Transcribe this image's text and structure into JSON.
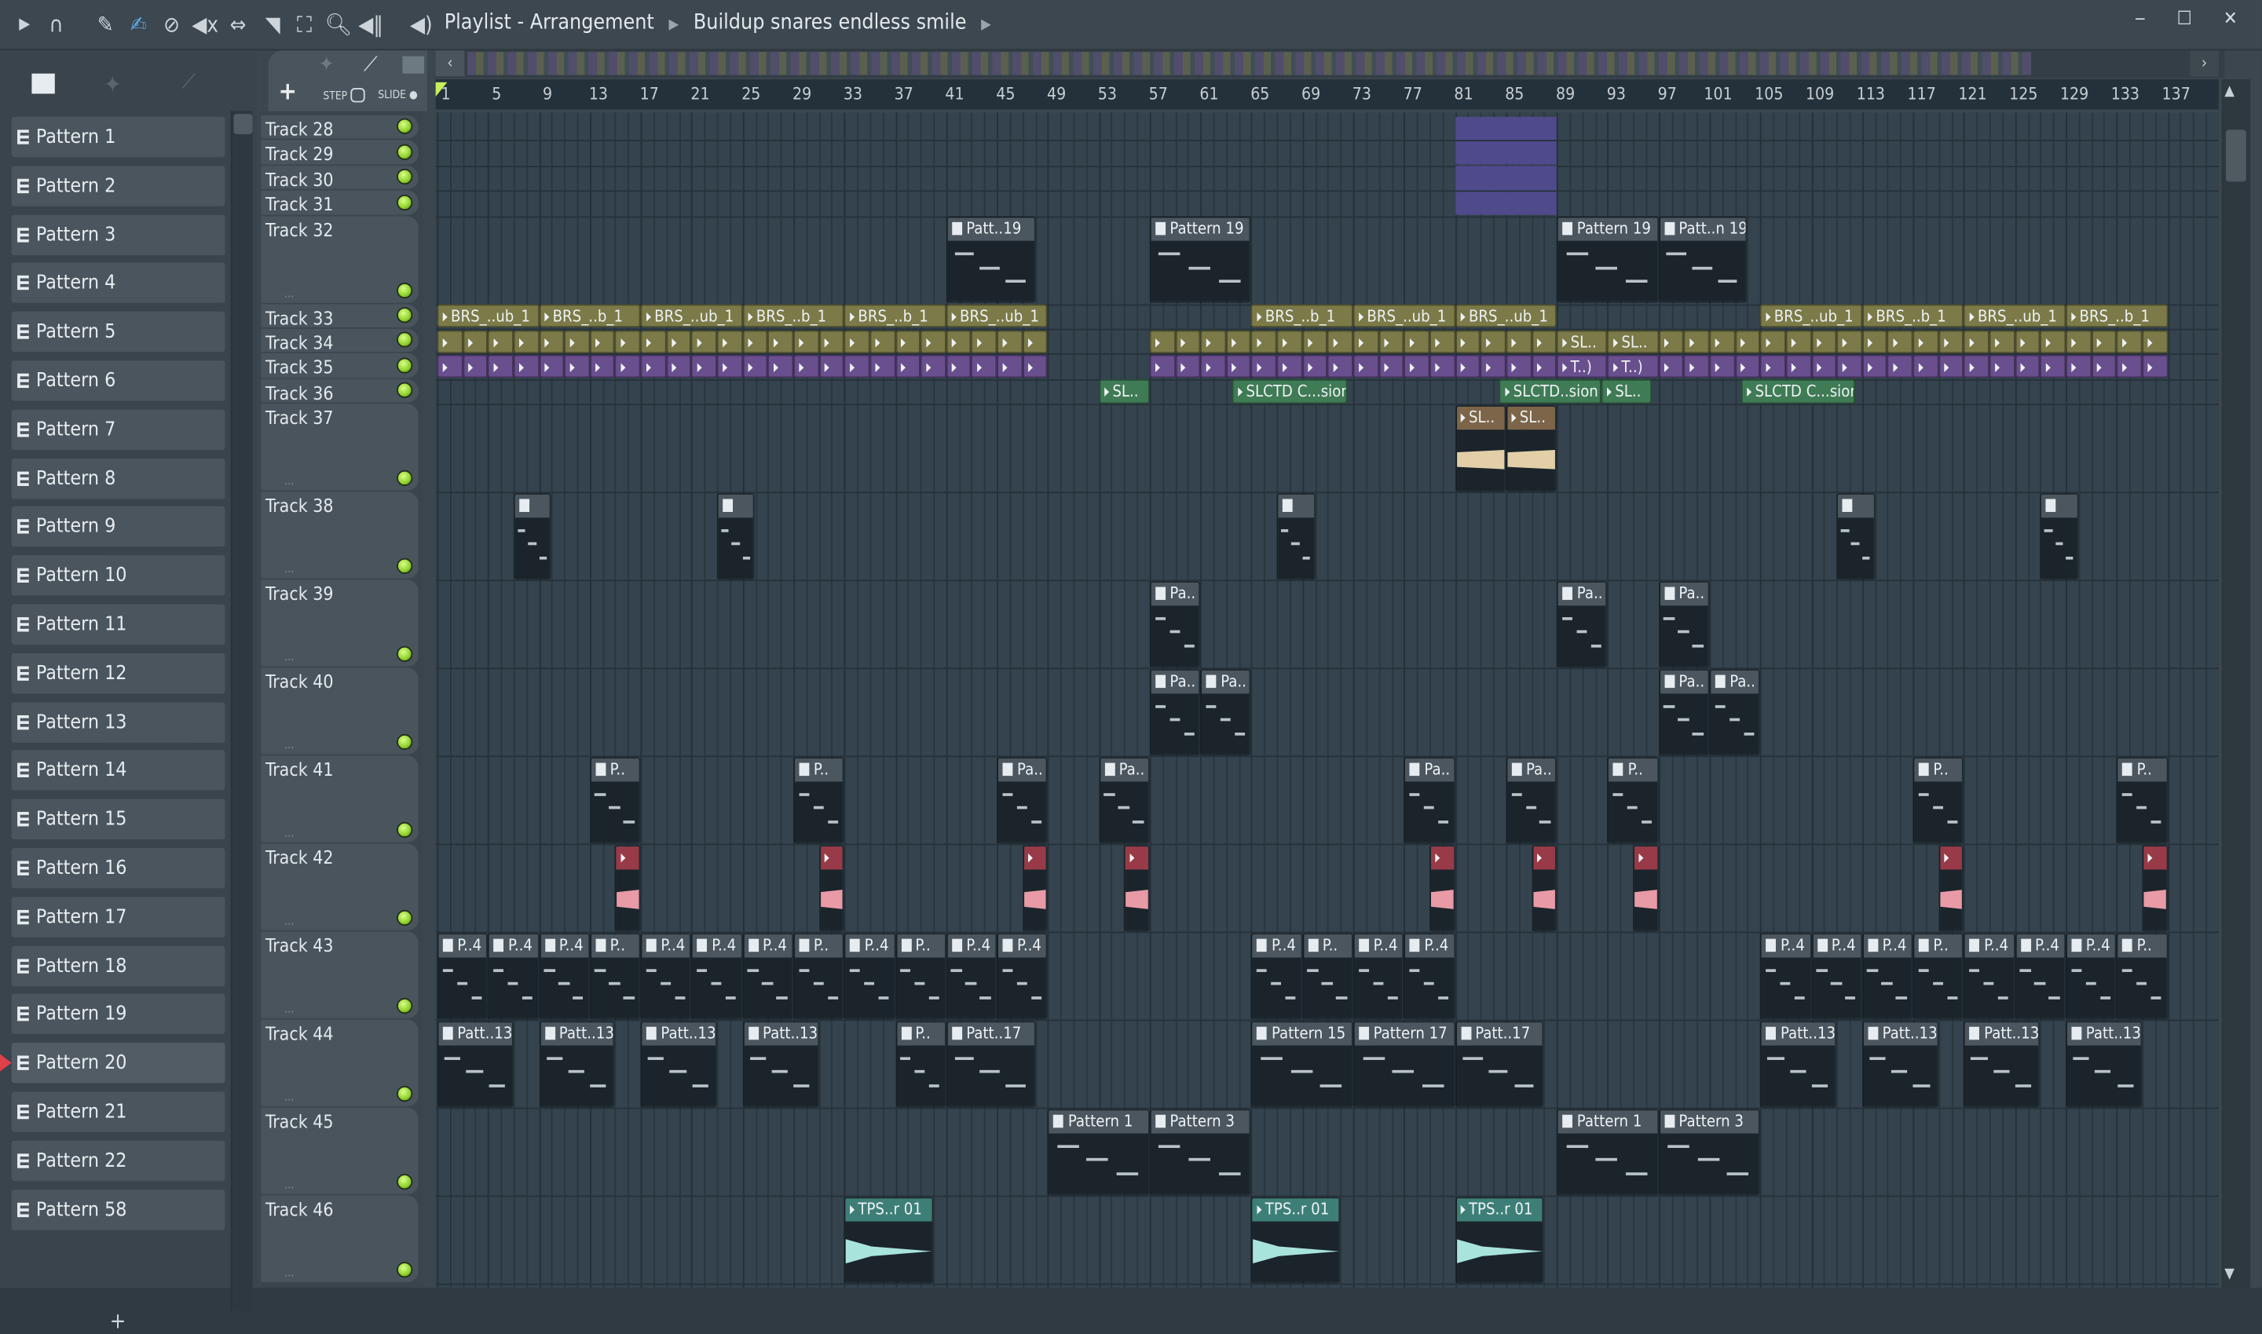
{
  "window": {
    "title": "Playlist - Arrangement",
    "breadcrumb": "Buildup snares endless smile",
    "controls": "‒ ☐ ✕"
  },
  "toolbar": {
    "icons": [
      "arrow-right-icon",
      "magnet-icon",
      "pencil-icon",
      "paint-icon",
      "delete-icon",
      "mute-icon",
      "slip-icon",
      "slice-icon",
      "select-icon",
      "zoom-icon",
      "playback-icon",
      "speaker-icon"
    ],
    "accent": "#5aa8e6"
  },
  "panel": {
    "step_label": "STEP",
    "slide_label": "SLIDE",
    "add_label": "+",
    "add_pattern_label": "+"
  },
  "patterns": [
    "Pattern 1",
    "Pattern 2",
    "Pattern 3",
    "Pattern 4",
    "Pattern 5",
    "Pattern 6",
    "Pattern 7",
    "Pattern 8",
    "Pattern 9",
    "Pattern 10",
    "Pattern 11",
    "Pattern 12",
    "Pattern 13",
    "Pattern 14",
    "Pattern 15",
    "Pattern 16",
    "Pattern 17",
    "Pattern 18",
    "Pattern 19",
    "Pattern 20",
    "Pattern 21",
    "Pattern 22",
    "Pattern 58"
  ],
  "selected_pattern": "Pattern 20",
  "ruler": {
    "labels": [
      1,
      5,
      9,
      13,
      17,
      21,
      25,
      29,
      33,
      37,
      41,
      45,
      49,
      53,
      57,
      61,
      65,
      69,
      73,
      77,
      81,
      85,
      89,
      93,
      97,
      101,
      105,
      109,
      113,
      117,
      121,
      125,
      129,
      133,
      137
    ]
  },
  "colors": {
    "pattern": "#4b565f",
    "olive": "#7b7a48",
    "purple": "#6a4f8f",
    "green": "#3f7b55",
    "brown": "#7c6548",
    "red": "#983a47",
    "teal": "#3d7f77",
    "block": "#4f4a8c"
  },
  "tracks": [
    {
      "name": "Track 28",
      "size": "s",
      "clips": [
        {
          "start": 81,
          "len": 8,
          "type": "block",
          "label": ""
        }
      ]
    },
    {
      "name": "Track 29",
      "size": "s",
      "clips": [
        {
          "start": 81,
          "len": 8,
          "type": "block",
          "label": ""
        }
      ]
    },
    {
      "name": "Track 30",
      "size": "s",
      "clips": [
        {
          "start": 81,
          "len": 8,
          "type": "block",
          "label": ""
        }
      ]
    },
    {
      "name": "Track 31",
      "size": "s",
      "clips": [
        {
          "start": 81,
          "len": 8,
          "type": "block",
          "label": ""
        }
      ]
    },
    {
      "name": "Track 32",
      "size": "l",
      "clips": [
        {
          "start": 41,
          "len": 7,
          "type": "pattern",
          "label": "Patt..19"
        },
        {
          "start": 57,
          "len": 8,
          "type": "pattern",
          "label": "Pattern 19"
        },
        {
          "start": 89,
          "len": 8,
          "type": "pattern",
          "label": "Pattern 19"
        },
        {
          "start": 97,
          "len": 7,
          "type": "pattern",
          "label": "Patt..n 19"
        }
      ]
    },
    {
      "name": "Track 33",
      "size": "s",
      "clips": [
        {
          "start": 1,
          "len": 8,
          "type": "olive",
          "label": "BRS_..ub_1"
        },
        {
          "start": 9,
          "len": 8,
          "type": "olive",
          "label": "BRS_..b_1"
        },
        {
          "start": 17,
          "len": 8,
          "type": "olive",
          "label": "BRS_..ub_1"
        },
        {
          "start": 25,
          "len": 8,
          "type": "olive",
          "label": "BRS_..b_1"
        },
        {
          "start": 33,
          "len": 8,
          "type": "olive",
          "label": "BRS_..b_1"
        },
        {
          "start": 41,
          "len": 8,
          "type": "olive",
          "label": "BRS_..ub_1"
        },
        {
          "start": 65,
          "len": 8,
          "type": "olive",
          "label": "BRS_..b_1"
        },
        {
          "start": 73,
          "len": 8,
          "type": "olive",
          "label": "BRS_..ub_1"
        },
        {
          "start": 81,
          "len": 8,
          "type": "olive",
          "label": "BRS_..ub_1"
        },
        {
          "start": 105,
          "len": 8,
          "type": "olive",
          "label": "BRS_..ub_1"
        },
        {
          "start": 113,
          "len": 8,
          "type": "olive",
          "label": "BRS_..b_1"
        },
        {
          "start": 121,
          "len": 8,
          "type": "olive",
          "label": "BRS_..ub_1"
        },
        {
          "start": 129,
          "len": 8,
          "type": "olive",
          "label": "BRS_..b_1"
        }
      ]
    },
    {
      "name": "Track 34",
      "size": "s",
      "repeat": [
        {
          "from": 1,
          "to": 49,
          "every": 2,
          "type": "olive"
        },
        {
          "from": 57,
          "to": 89,
          "every": 2,
          "type": "olive"
        },
        {
          "from": 97,
          "to": 105,
          "every": 2,
          "type": "olive"
        },
        {
          "from": 105,
          "to": 137,
          "every": 2,
          "type": "olive"
        }
      ],
      "clips": [
        {
          "start": 89,
          "len": 4,
          "type": "olive",
          "label": "SL.."
        },
        {
          "start": 93,
          "len": 4,
          "type": "olive",
          "label": "SL.."
        }
      ]
    },
    {
      "name": "Track 35",
      "size": "s",
      "repeat": [
        {
          "from": 1,
          "to": 49,
          "every": 2,
          "type": "purple"
        },
        {
          "from": 57,
          "to": 89,
          "every": 2,
          "type": "purple"
        },
        {
          "from": 97,
          "to": 137,
          "every": 2,
          "type": "purple"
        }
      ],
      "clips": [
        {
          "start": 89,
          "len": 4,
          "type": "purple",
          "label": "T..)"
        },
        {
          "start": 93,
          "len": 4,
          "type": "purple",
          "label": "T..)"
        }
      ]
    },
    {
      "name": "Track 36",
      "size": "s",
      "clips": [
        {
          "start": 53,
          "len": 4,
          "type": "green",
          "label": "SL.."
        },
        {
          "start": 63.5,
          "len": 9,
          "type": "green",
          "label": "SLCTD C...sion"
        },
        {
          "start": 84.5,
          "len": 8,
          "type": "green",
          "label": "SLCTD..sion"
        },
        {
          "start": 92.5,
          "len": 4,
          "type": "green",
          "label": "SL.."
        },
        {
          "start": 103.5,
          "len": 9,
          "type": "green",
          "label": "SLCTD C...sion"
        }
      ]
    },
    {
      "name": "Track 37",
      "size": "l",
      "clips": [
        {
          "start": 81,
          "len": 4,
          "type": "brown",
          "label": "SL..",
          "wave": true
        },
        {
          "start": 85,
          "len": 4,
          "type": "brown",
          "label": "SL..",
          "wave": true
        }
      ]
    },
    {
      "name": "Track 38",
      "size": "l",
      "clips": [
        {
          "start": 7,
          "len": 3,
          "type": "pattern",
          "label": ""
        },
        {
          "start": 23,
          "len": 3,
          "type": "pattern",
          "label": ""
        },
        {
          "start": 67,
          "len": 3,
          "type": "pattern",
          "label": ""
        },
        {
          "start": 111,
          "len": 3,
          "type": "pattern",
          "label": ""
        },
        {
          "start": 127,
          "len": 3,
          "type": "pattern",
          "label": ""
        }
      ]
    },
    {
      "name": "Track 39",
      "size": "l",
      "clips": [
        {
          "start": 57,
          "len": 4,
          "type": "pattern",
          "label": "Pa.."
        },
        {
          "start": 89,
          "len": 4,
          "type": "pattern",
          "label": "Pa.."
        },
        {
          "start": 97,
          "len": 4,
          "type": "pattern",
          "label": "Pa.."
        }
      ]
    },
    {
      "name": "Track 40",
      "size": "l",
      "clips": [
        {
          "start": 57,
          "len": 4,
          "type": "pattern",
          "label": "Pa.."
        },
        {
          "start": 61,
          "len": 4,
          "type": "pattern",
          "label": "Pa.."
        },
        {
          "start": 97,
          "len": 4,
          "type": "pattern",
          "label": "Pa.."
        },
        {
          "start": 101,
          "len": 4,
          "type": "pattern",
          "label": "Pa.."
        }
      ]
    },
    {
      "name": "Track 41",
      "size": "l",
      "clips": [
        {
          "start": 13,
          "len": 4,
          "type": "pattern",
          "label": "P.."
        },
        {
          "start": 29,
          "len": 4,
          "type": "pattern",
          "label": "P.."
        },
        {
          "start": 45,
          "len": 4,
          "type": "pattern",
          "label": "Pa.."
        },
        {
          "start": 53,
          "len": 4,
          "type": "pattern",
          "label": "Pa.."
        },
        {
          "start": 77,
          "len": 4,
          "type": "pattern",
          "label": "Pa.."
        },
        {
          "start": 85,
          "len": 4,
          "type": "pattern",
          "label": "Pa.."
        },
        {
          "start": 93,
          "len": 4,
          "type": "pattern",
          "label": "P.."
        },
        {
          "start": 117,
          "len": 4,
          "type": "pattern",
          "label": "P.."
        },
        {
          "start": 133,
          "len": 4,
          "type": "pattern",
          "label": "P.."
        }
      ]
    },
    {
      "name": "Track 42",
      "size": "l",
      "clips": [
        {
          "start": 15,
          "len": 2,
          "type": "red",
          "label": "",
          "wave": true
        },
        {
          "start": 31,
          "len": 2,
          "type": "red",
          "label": "",
          "wave": true
        },
        {
          "start": 47,
          "len": 2,
          "type": "red",
          "label": "",
          "wave": true
        },
        {
          "start": 55,
          "len": 2,
          "type": "red",
          "label": "",
          "wave": true
        },
        {
          "start": 79,
          "len": 2,
          "type": "red",
          "label": "",
          "wave": true
        },
        {
          "start": 87,
          "len": 2,
          "type": "red",
          "label": "",
          "wave": true
        },
        {
          "start": 95,
          "len": 2,
          "type": "red",
          "label": "",
          "wave": true
        },
        {
          "start": 119,
          "len": 2,
          "type": "red",
          "label": "",
          "wave": true
        },
        {
          "start": 135,
          "len": 2,
          "type": "red",
          "label": "",
          "wave": true
        }
      ]
    },
    {
      "name": "Track 43",
      "size": "l",
      "clips": [
        {
          "start": 1,
          "len": 4,
          "type": "pattern",
          "label": "P..4"
        },
        {
          "start": 5,
          "len": 4,
          "type": "pattern",
          "label": "P..4"
        },
        {
          "start": 9,
          "len": 4,
          "type": "pattern",
          "label": "P..4"
        },
        {
          "start": 13,
          "len": 4,
          "type": "pattern",
          "label": "P.."
        },
        {
          "start": 17,
          "len": 4,
          "type": "pattern",
          "label": "P..4"
        },
        {
          "start": 21,
          "len": 4,
          "type": "pattern",
          "label": "P..4"
        },
        {
          "start": 25,
          "len": 4,
          "type": "pattern",
          "label": "P..4"
        },
        {
          "start": 29,
          "len": 4,
          "type": "pattern",
          "label": "P.."
        },
        {
          "start": 33,
          "len": 4,
          "type": "pattern",
          "label": "P..4"
        },
        {
          "start": 37,
          "len": 4,
          "type": "pattern",
          "label": "P.."
        },
        {
          "start": 41,
          "len": 4,
          "type": "pattern",
          "label": "P..4"
        },
        {
          "start": 45,
          "len": 4,
          "type": "pattern",
          "label": "P..4"
        },
        {
          "start": 65,
          "len": 4,
          "type": "pattern",
          "label": "P..4"
        },
        {
          "start": 69,
          "len": 4,
          "type": "pattern",
          "label": "P.."
        },
        {
          "start": 73,
          "len": 4,
          "type": "pattern",
          "label": "P..4"
        },
        {
          "start": 77,
          "len": 4,
          "type": "pattern",
          "label": "P..4"
        },
        {
          "start": 105,
          "len": 4,
          "type": "pattern",
          "label": "P..4"
        },
        {
          "start": 109,
          "len": 4,
          "type": "pattern",
          "label": "P..4"
        },
        {
          "start": 113,
          "len": 4,
          "type": "pattern",
          "label": "P..4"
        },
        {
          "start": 117,
          "len": 4,
          "type": "pattern",
          "label": "P.."
        },
        {
          "start": 121,
          "len": 4,
          "type": "pattern",
          "label": "P..4"
        },
        {
          "start": 125,
          "len": 4,
          "type": "pattern",
          "label": "P..4"
        },
        {
          "start": 129,
          "len": 4,
          "type": "pattern",
          "label": "P..4"
        },
        {
          "start": 133,
          "len": 4,
          "type": "pattern",
          "label": "P.."
        }
      ]
    },
    {
      "name": "Track 44",
      "size": "l",
      "clips": [
        {
          "start": 1,
          "len": 6,
          "type": "pattern",
          "label": "Patt..13"
        },
        {
          "start": 9,
          "len": 6,
          "type": "pattern",
          "label": "Patt..13"
        },
        {
          "start": 17,
          "len": 6,
          "type": "pattern",
          "label": "Patt..13"
        },
        {
          "start": 25,
          "len": 6,
          "type": "pattern",
          "label": "Patt..13"
        },
        {
          "start": 37,
          "len": 4,
          "type": "pattern",
          "label": "P.."
        },
        {
          "start": 41,
          "len": 7,
          "type": "pattern",
          "label": "Patt..17"
        },
        {
          "start": 65,
          "len": 8,
          "type": "pattern",
          "label": "Pattern 15"
        },
        {
          "start": 73,
          "len": 8,
          "type": "pattern",
          "label": "Pattern 17"
        },
        {
          "start": 81,
          "len": 7,
          "type": "pattern",
          "label": "Patt..17"
        },
        {
          "start": 105,
          "len": 6,
          "type": "pattern",
          "label": "Patt..13"
        },
        {
          "start": 113,
          "len": 6,
          "type": "pattern",
          "label": "Patt..13"
        },
        {
          "start": 121,
          "len": 6,
          "type": "pattern",
          "label": "Patt..13"
        },
        {
          "start": 129,
          "len": 6,
          "type": "pattern",
          "label": "Patt..13"
        }
      ]
    },
    {
      "name": "Track 45",
      "size": "l",
      "clips": [
        {
          "start": 49,
          "len": 8,
          "type": "pattern",
          "label": "Pattern 1"
        },
        {
          "start": 57,
          "len": 8,
          "type": "pattern",
          "label": "Pattern 3"
        },
        {
          "start": 89,
          "len": 8,
          "type": "pattern",
          "label": "Pattern 1"
        },
        {
          "start": 97,
          "len": 8,
          "type": "pattern",
          "label": "Pattern 3"
        }
      ]
    },
    {
      "name": "Track 46",
      "size": "l",
      "clips": [
        {
          "start": 33,
          "len": 7,
          "type": "teal",
          "label": "TPS..r 01",
          "wave": true
        },
        {
          "start": 65,
          "len": 7,
          "type": "teal",
          "label": "TPS..r 01",
          "wave": true
        },
        {
          "start": 81,
          "len": 7,
          "type": "teal",
          "label": "TPS..r 01",
          "wave": true
        }
      ]
    }
  ]
}
